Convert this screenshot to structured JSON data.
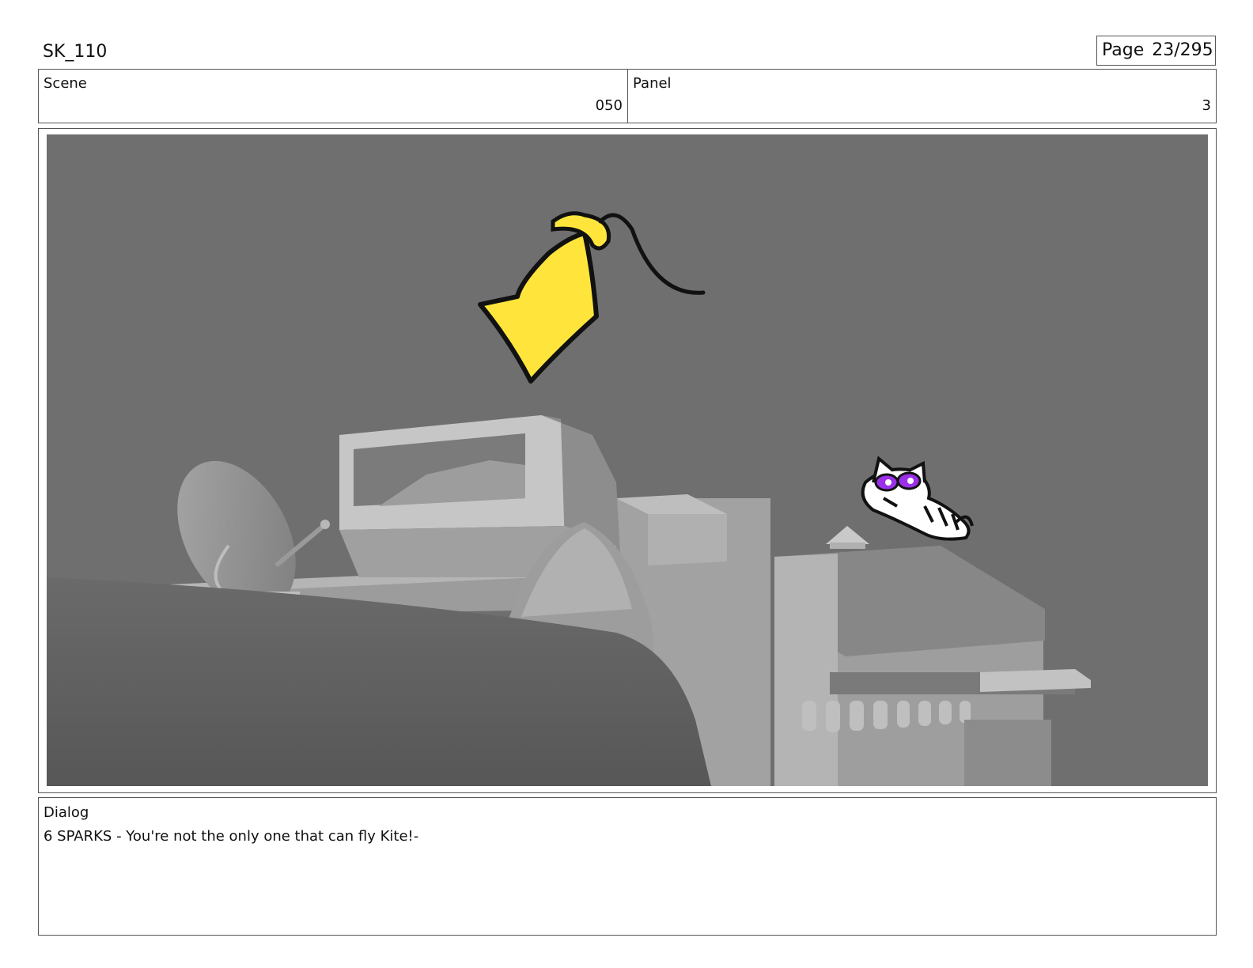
{
  "header": {
    "doc_title": "SK_110",
    "page_label": "Page",
    "page_number": "23/295"
  },
  "info": {
    "scene_label": "Scene",
    "scene_value": "050",
    "panel_label": "Panel",
    "panel_value": "3"
  },
  "frame": {
    "colors": {
      "background": "#6f6f6f",
      "kite": "#ffe53b",
      "eyes": "#9b30e8"
    }
  },
  "dialog": {
    "label": "Dialog",
    "text": "6 SPARKS - You're not the only one that can fly Kite!-"
  }
}
